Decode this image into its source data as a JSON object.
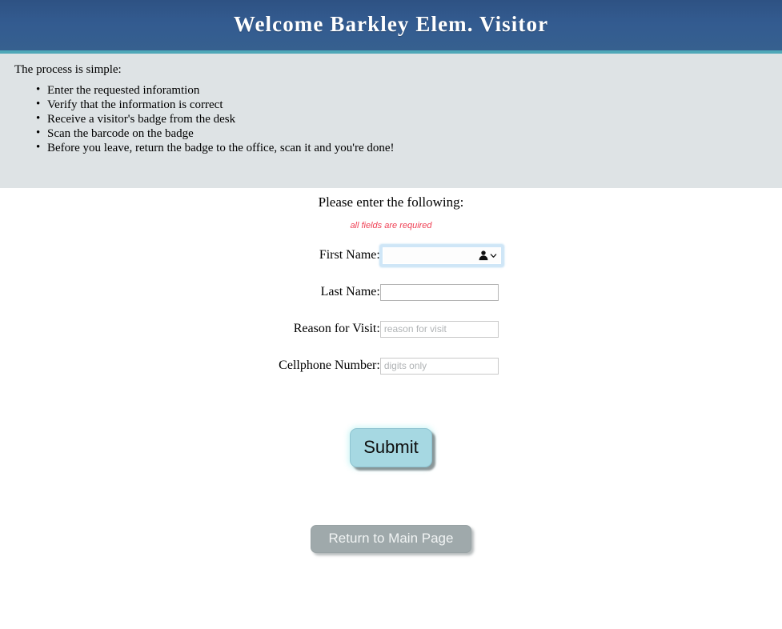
{
  "header": {
    "title": "Welcome Barkley Elem. Visitor",
    "bg_color": "#335b90",
    "accent_color": "#4fa8b8"
  },
  "instructions": {
    "lead": "The process is simple:",
    "steps": [
      "Enter the requested inforamtion",
      "Verify that the information is correct",
      "Receive a visitor's badge from the desk",
      "Scan the barcode on the badge",
      "Before you leave, return the badge to the office, scan it and you're done!"
    ]
  },
  "form": {
    "heading": "Please enter the following:",
    "required_note": "all fields are required",
    "required_note_color": "#ef4155",
    "fields": [
      {
        "label": "First Name:",
        "value": "",
        "placeholder": "",
        "focused": true,
        "autofill_icon": "person-icon"
      },
      {
        "label": "Last Name:",
        "value": "",
        "placeholder": "",
        "focused": false
      },
      {
        "label": "Reason for Visit:",
        "value": "",
        "placeholder": "reason for visit",
        "focused": false
      },
      {
        "label": "Cellphone Number:",
        "value": "",
        "placeholder": "digits only",
        "focused": false
      }
    ],
    "submit_label": "Submit",
    "submit_color": "#a6d8e2",
    "return_label": "Return to Main Page",
    "return_color": "#9fa9ab"
  }
}
